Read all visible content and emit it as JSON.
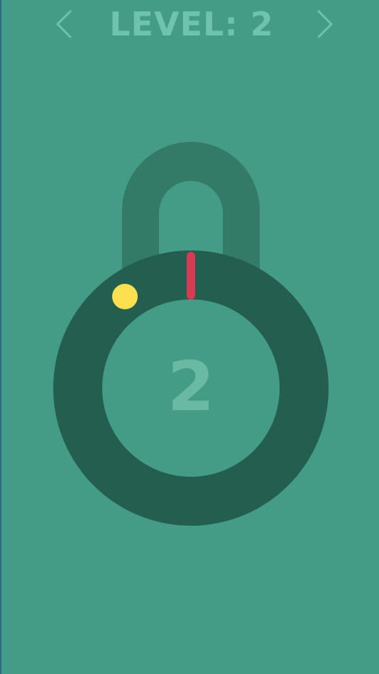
{
  "header": {
    "level_title": "LEVEL: 2",
    "prev_icon": "chevron-left-icon",
    "next_icon": "chevron-right-icon"
  },
  "lock": {
    "remaining_count": "2",
    "colors": {
      "background": "#449b86",
      "shackle": "#337b66",
      "ring": "#245e4f",
      "target_dot": "#fce04f",
      "needle": "#d63a55",
      "count_text": "#6ab9a3",
      "title_text": "#6fc2ad"
    }
  }
}
